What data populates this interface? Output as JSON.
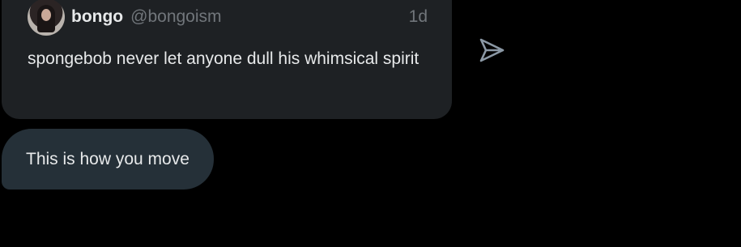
{
  "quoted_post": {
    "display_name": "bongo",
    "handle": "@bongoism",
    "time": "1d",
    "text": "spongebob never let anyone dull his whimsical spirit",
    "avatar_icon": "profile-photo"
  },
  "share": {
    "icon": "send-icon"
  },
  "message": {
    "text": "This is how you move"
  },
  "colors": {
    "background": "#000000",
    "card": "#1e2124",
    "bubble": "#253038",
    "text_primary": "#e7e9ea",
    "text_secondary": "#71767b"
  }
}
